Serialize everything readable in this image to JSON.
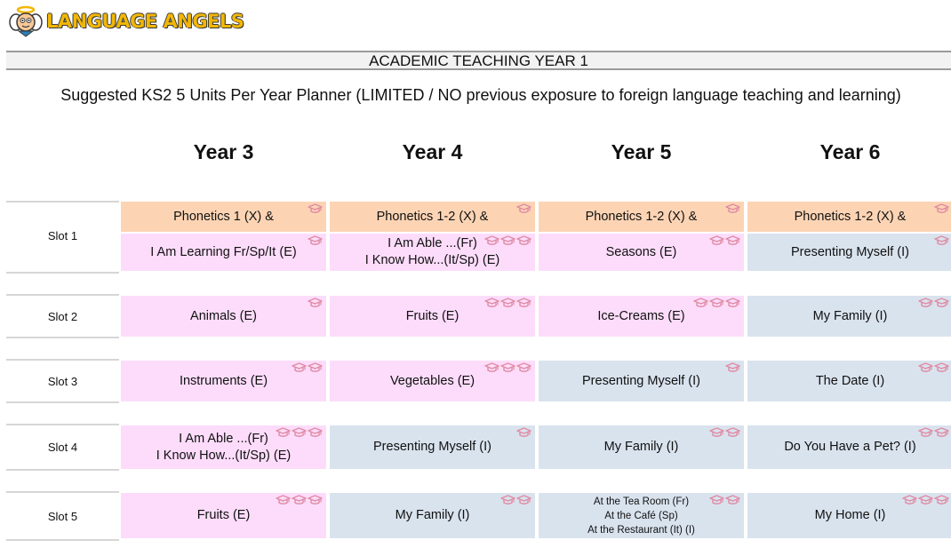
{
  "brand": {
    "logo_text": "LANGUAGE ANGELS"
  },
  "title": "ACADEMIC TEACHING YEAR 1",
  "subtitle": "Suggested KS2 5 Units Per Year Planner (LIMITED / NO previous exposure to foreign language teaching and learning)",
  "colors": {
    "pink": "#fcdcfa",
    "blue": "#d9e3ee",
    "peach": "#fcd4b4",
    "cap_icon": "#e08aa4"
  },
  "years": [
    "Year 3",
    "Year 4",
    "Year 5",
    "Year 6"
  ],
  "slots": [
    {
      "label": "Slot 1",
      "phonetics": [
        {
          "text": "Phonetics 1 (X) &",
          "caps": 1
        },
        {
          "text": "Phonetics 1-2 (X) &",
          "caps": 1
        },
        {
          "text": "Phonetics 1-2 (X) &",
          "caps": 1
        },
        {
          "text": "Phonetics 1-2 (X) &",
          "caps": 1
        }
      ],
      "cells": [
        {
          "lines": [
            "I Am Learning Fr/Sp/It (E)"
          ],
          "color": "pink",
          "caps": 1
        },
        {
          "lines": [
            "I Am Able ...(Fr)",
            "I Know How...(It/Sp) (E)"
          ],
          "color": "pink",
          "caps": 3
        },
        {
          "lines": [
            "Seasons (E)"
          ],
          "color": "pink",
          "caps": 2
        },
        {
          "lines": [
            "Presenting Myself (I)"
          ],
          "color": "blue",
          "caps": 1
        }
      ]
    },
    {
      "label": "Slot 2",
      "cells": [
        {
          "lines": [
            "Animals (E)"
          ],
          "color": "pink",
          "caps": 1
        },
        {
          "lines": [
            "Fruits (E)"
          ],
          "color": "pink",
          "caps": 3
        },
        {
          "lines": [
            "Ice-Creams (E)"
          ],
          "color": "pink",
          "caps": 3
        },
        {
          "lines": [
            "My Family (I)"
          ],
          "color": "blue",
          "caps": 2
        }
      ]
    },
    {
      "label": "Slot 3",
      "cells": [
        {
          "lines": [
            "Instruments (E)"
          ],
          "color": "pink",
          "caps": 2
        },
        {
          "lines": [
            "Vegetables (E)"
          ],
          "color": "pink",
          "caps": 3
        },
        {
          "lines": [
            "Presenting Myself (I)"
          ],
          "color": "blue",
          "caps": 1
        },
        {
          "lines": [
            "The Date (I)"
          ],
          "color": "blue",
          "caps": 2
        }
      ]
    },
    {
      "label": "Slot 4",
      "cells": [
        {
          "lines": [
            "I Am Able ...(Fr)",
            "I Know How...(It/Sp) (E)"
          ],
          "color": "pink",
          "caps": 3
        },
        {
          "lines": [
            "Presenting Myself (I)"
          ],
          "color": "blue",
          "caps": 1
        },
        {
          "lines": [
            "My Family (I)"
          ],
          "color": "blue",
          "caps": 2
        },
        {
          "lines": [
            "Do You Have a Pet? (I)"
          ],
          "color": "blue",
          "caps": 2
        }
      ]
    },
    {
      "label": "Slot 5",
      "cells": [
        {
          "lines": [
            "Fruits (E)"
          ],
          "color": "pink",
          "caps": 3
        },
        {
          "lines": [
            "My Family (I)"
          ],
          "color": "blue",
          "caps": 2
        },
        {
          "lines": [
            "At the Tea Room (Fr)",
            "At the Café (Sp)",
            "At the Restaurant (It) (I)"
          ],
          "color": "blue",
          "caps": 2,
          "small": true
        },
        {
          "lines": [
            "My Home (I)"
          ],
          "color": "blue",
          "caps": 3
        }
      ]
    }
  ]
}
